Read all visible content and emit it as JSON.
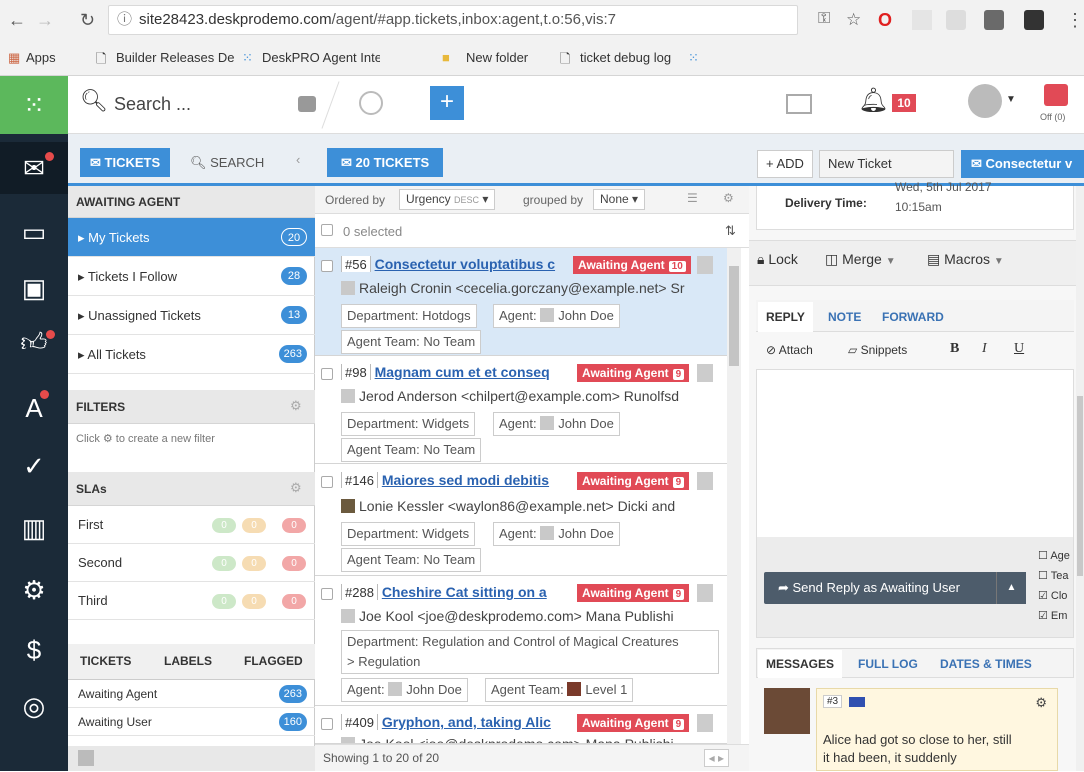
{
  "browser": {
    "url_host": "site28423.deskprodemo.com",
    "url_path": "/agent/#app.tickets,inbox:agent,t.o:56,vis:7",
    "bookmarks": [
      "Apps",
      "Builder Releases Desk",
      "DeskPRO Agent Inter",
      "New folder",
      "ticket debug log"
    ]
  },
  "topbar": {
    "search_placeholder": "Search ...",
    "notif_count": "10",
    "off_label": "Off (0)",
    "add_label": "+"
  },
  "pane": {
    "tab_tickets": "TICKETS",
    "tab_search": "SEARCH",
    "awaiting_header": "AWAITING AGENT",
    "items": [
      {
        "label": "My Tickets",
        "count": "20"
      },
      {
        "label": "Tickets I Follow",
        "count": "28"
      },
      {
        "label": "Unassigned Tickets",
        "count": "13"
      },
      {
        "label": "All Tickets",
        "count": "263"
      }
    ],
    "filters_header": "FILTERS",
    "filters_hint": "Click ⚙ to create a new filter",
    "slas_header": "SLAs",
    "slas": [
      {
        "label": "First",
        "v": [
          "0",
          "0",
          "0"
        ]
      },
      {
        "label": "Second",
        "v": [
          "0",
          "0",
          "0"
        ]
      },
      {
        "label": "Third",
        "v": [
          "0",
          "0",
          "0"
        ]
      }
    ],
    "bottom_tabs": [
      "TICKETS",
      "LABELS",
      "FLAGGED"
    ],
    "status": [
      {
        "label": "Awaiting Agent",
        "count": "263"
      },
      {
        "label": "Awaiting User",
        "count": "160"
      }
    ]
  },
  "list": {
    "title": "20 TICKETS",
    "ordered_by": "Ordered by",
    "urgency": "Urgency",
    "desc": "DESC",
    "grouped_by": "grouped by",
    "none": "None",
    "selected": "0 selected",
    "footer": "Showing 1 to 20 of 20",
    "tickets": [
      {
        "num": "#56",
        "subject": "Consectetur voluptatibus c",
        "status": "Awaiting Agent",
        "urg": "10",
        "person": "Raleigh Cronin <cecelia.gorczany@example.net> Sr",
        "dept": "Department: Hotdogs",
        "agent": "Agent:",
        "agent_name": "John Doe",
        "team": "Agent Team: No Team"
      },
      {
        "num": "#98",
        "subject": "Magnam cum et et conseq",
        "status": "Awaiting Agent",
        "urg": "9",
        "person": "Jerod Anderson <chilpert@example.com> Runolfsd",
        "dept": "Department: Widgets",
        "agent": "Agent:",
        "agent_name": "John Doe",
        "team": "Agent Team: No Team"
      },
      {
        "num": "#146",
        "subject": "Maiores sed modi debitis",
        "status": "Awaiting Agent",
        "urg": "9",
        "person": "Lonie Kessler <waylon86@example.net> Dicki and",
        "dept": "Department: Widgets",
        "agent": "Agent:",
        "agent_name": "John Doe",
        "team": "Agent Team: No Team"
      },
      {
        "num": "#288",
        "subject": "Cheshire Cat sitting on a",
        "status": "Awaiting Agent",
        "urg": "9",
        "person": "Joe Kool <joe@deskprodemo.com> Mana Publishi",
        "dept": "Department: Regulation and Control of Magical Creatures",
        "dept2": "> Regulation",
        "agent": "Agent:",
        "agent_name": "John Doe",
        "team": "Agent Team:",
        "team_name": "Level 1"
      },
      {
        "num": "#409",
        "subject": "Gryphon, and, taking Alic",
        "status": "Awaiting Agent",
        "urg": "9",
        "person": "Joe Kool <joe@deskprodemo.com> Mana Publishi"
      }
    ]
  },
  "detail": {
    "add": "+ ADD",
    "new_ticket": "New Ticket",
    "active_tab": "Consectetur v",
    "delivery_label": "Delivery Time:",
    "delivery_value1": "Wed, 5th Jul 2017",
    "delivery_value2": "10:15am",
    "lock": "Lock",
    "merge": "Merge",
    "macros": "Macros",
    "reply_tabs": [
      "REPLY",
      "NOTE",
      "FORWARD"
    ],
    "attach": "Attach",
    "snippets": "Snippets",
    "bold": "B",
    "italic": "I",
    "underline": "U",
    "send": "Send Reply as Awaiting User",
    "checks": [
      "Age",
      "Tea",
      "Clo",
      "Em"
    ],
    "msg_tabs": [
      "MESSAGES",
      "FULL LOG",
      "DATES & TIMES"
    ],
    "msg_num": "#3",
    "msg_text1": "Alice had got so close to her, still",
    "msg_text2": "it had been, it suddenly"
  }
}
